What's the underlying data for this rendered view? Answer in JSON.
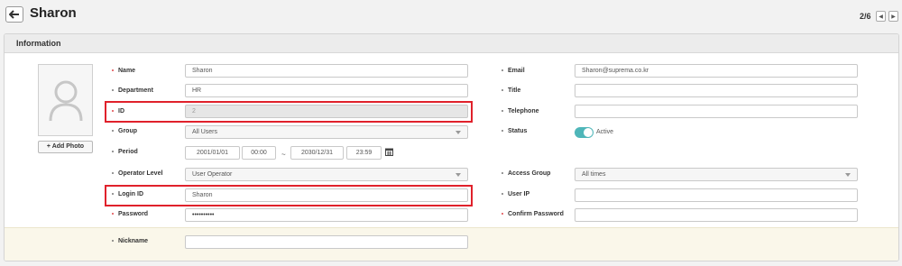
{
  "header": {
    "title": "Sharon",
    "pager": "2/6"
  },
  "section": {
    "title": "Information"
  },
  "photo": {
    "add_label": "+ Add Photo"
  },
  "left": {
    "name_label": "Name",
    "name_value": "Sharon",
    "department_label": "Department",
    "department_value": "HR",
    "id_label": "ID",
    "id_value": "2",
    "group_label": "Group",
    "group_value": "All Users",
    "period_label": "Period",
    "period_start_date": "2001/01/01",
    "period_start_time": "00:00",
    "period_sep": "~",
    "period_end_date": "2030/12/31",
    "period_end_time": "23:59",
    "operator_label": "Operator Level",
    "operator_value": "User Operator",
    "login_label": "Login ID",
    "login_value": "Sharon",
    "password_label": "Password",
    "password_value": "••••••••••",
    "nickname_label": "Nickname",
    "nickname_value": ""
  },
  "right": {
    "email_label": "Email",
    "email_value": "Sharon@suprema.co.kr",
    "title_label": "Title",
    "title_value": "",
    "telephone_label": "Telephone",
    "telephone_value": "",
    "status_label": "Status",
    "status_value": "Active",
    "access_label": "Access Group",
    "access_value": "All times",
    "userip_label": "User IP",
    "userip_value": "",
    "confirm_label": "Confirm Password",
    "confirm_value": ""
  },
  "colors": {
    "required_dot": "#e0474c",
    "toggle_on": "#4fb6b9",
    "highlight": "#e0212b"
  }
}
